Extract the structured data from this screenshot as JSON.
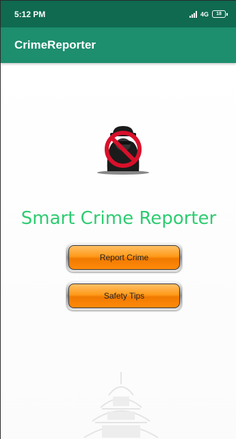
{
  "status_bar": {
    "time": "5:12 PM",
    "network": "4G",
    "battery": "18"
  },
  "app_bar": {
    "title": "CrimeReporter"
  },
  "main": {
    "headline": "Smart Crime Reporter",
    "buttons": {
      "report_crime": "Report Crime",
      "safety_tips": "Safety Tips"
    },
    "logo_icon": "no-thief-icon",
    "watermark_icon": "building-watermark"
  },
  "colors": {
    "status_bar": "#0f6a50",
    "app_bar": "#1d8e6e",
    "headline": "#2ecc71",
    "button_orange": "#ff9a1a"
  }
}
